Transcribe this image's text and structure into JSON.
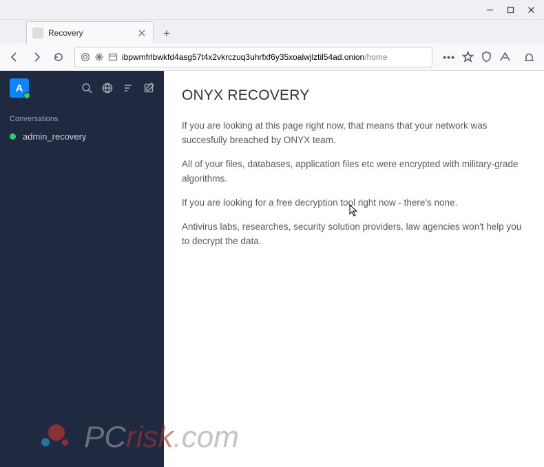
{
  "window": {
    "tab_title": "Recovery"
  },
  "address": {
    "domain": "ibpwmfrlbwkfd4asg57t4x2vkrczuq3uhrfxf6y35xoalwjlztil54ad.onion",
    "path": "/home"
  },
  "sidebar": {
    "avatar_initial": "A",
    "section_label": "Conversations",
    "items": [
      {
        "label": "admin_recovery"
      }
    ]
  },
  "main": {
    "title": "ONYX RECOVERY",
    "paragraphs": [
      "If you are looking at this page right now, that means that your network was succesfully breached by ONYX team.",
      "All of your files, databases, application files etc were encrypted with military-grade algorithms.",
      "If you are looking for a free decryption tool right now - there's none.",
      "Antivirus labs, researches, security solution providers, law agencies won't help you to decrypt the data."
    ]
  },
  "watermark": {
    "pc": "PC",
    "risk": "risk",
    "com": ".com"
  }
}
